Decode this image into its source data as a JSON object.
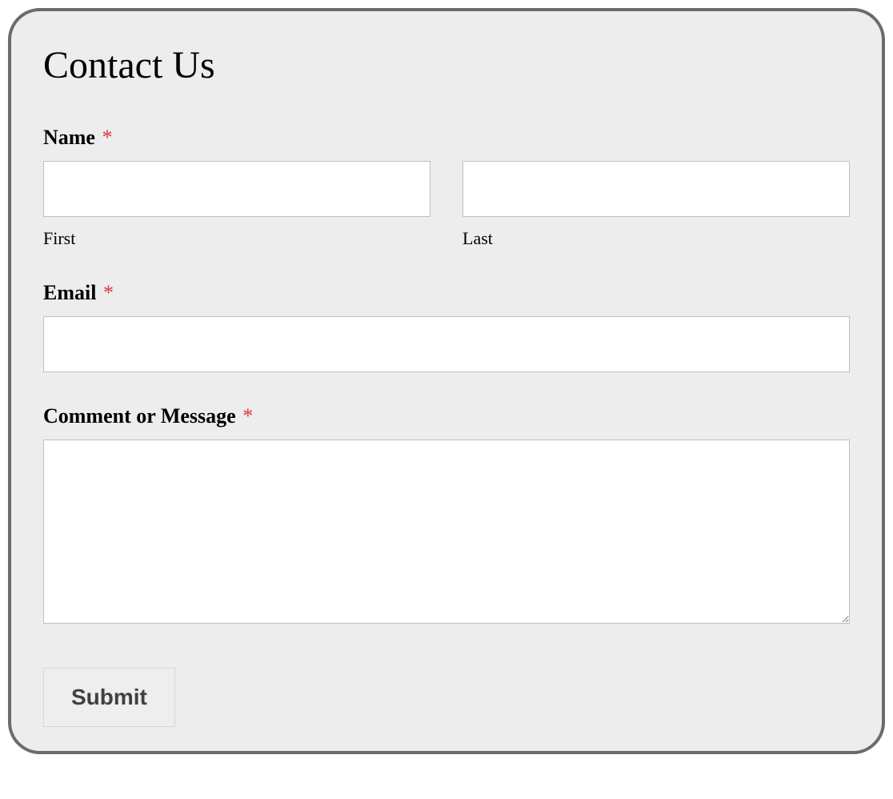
{
  "form": {
    "title": "Contact Us",
    "required_marker": "*",
    "fields": {
      "name": {
        "label": "Name",
        "first_sublabel": "First",
        "last_sublabel": "Last",
        "first_value": "",
        "last_value": ""
      },
      "email": {
        "label": "Email",
        "value": ""
      },
      "message": {
        "label": "Comment or Message",
        "value": ""
      }
    },
    "submit_label": "Submit"
  }
}
